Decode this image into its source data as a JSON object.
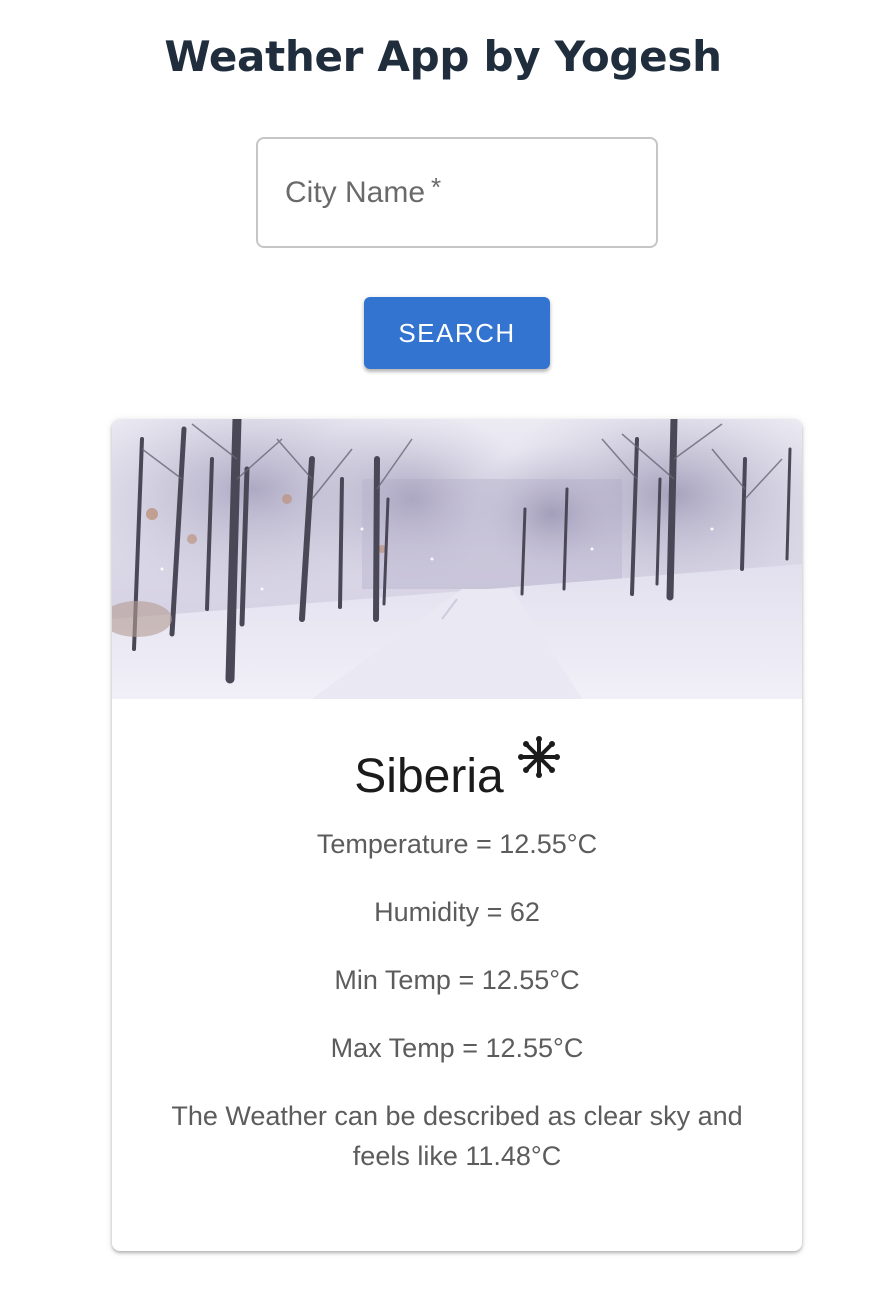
{
  "header": {
    "title": "Weather App by Yogesh"
  },
  "search": {
    "label": "City Name",
    "required_mark": "*",
    "value": "",
    "button_label": "SEARCH"
  },
  "card": {
    "image": "snowy-park-path",
    "city": "Siberia",
    "weather_icon": "snowflake-icon",
    "temperature": "Temperature = 12.55°C",
    "humidity": "Humidity = 62",
    "min_temp": "Min Temp = 12.55°C",
    "max_temp": "Max Temp = 12.55°C",
    "description": "The Weather can be described as clear sky and feels like 11.48°C"
  },
  "colors": {
    "title": "#1f2d3d",
    "button": "#3374d0",
    "text": "#5c5c5c"
  }
}
